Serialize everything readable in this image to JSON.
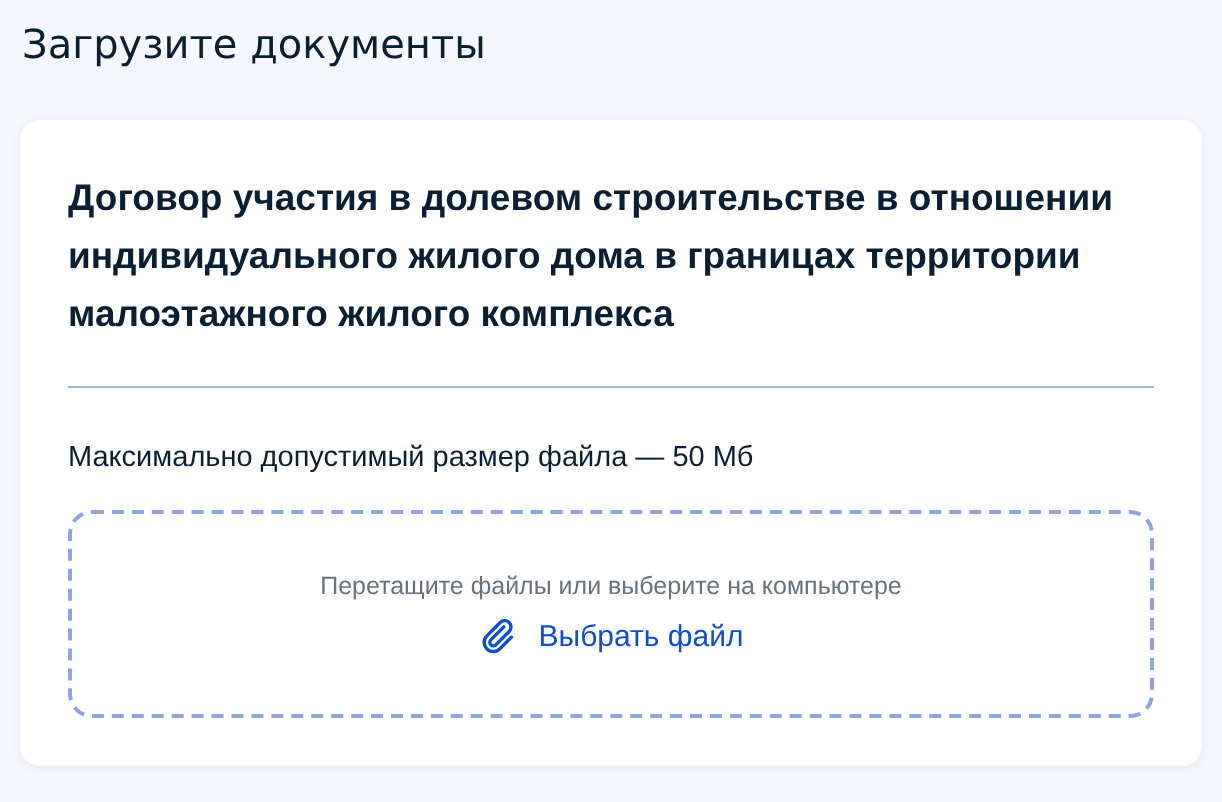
{
  "page": {
    "title": "Загрузите документы"
  },
  "card": {
    "heading": "Договор участия в долевом строительстве в отношении индивидуального жилого дома в границах территории малоэтажного жилого комплекса",
    "size_note": "Максимально допустимый размер файла — 50 Мб",
    "dropzone": {
      "hint": "Перетащите файлы или выберите на компьютере",
      "link": "Выбрать файл"
    }
  }
}
